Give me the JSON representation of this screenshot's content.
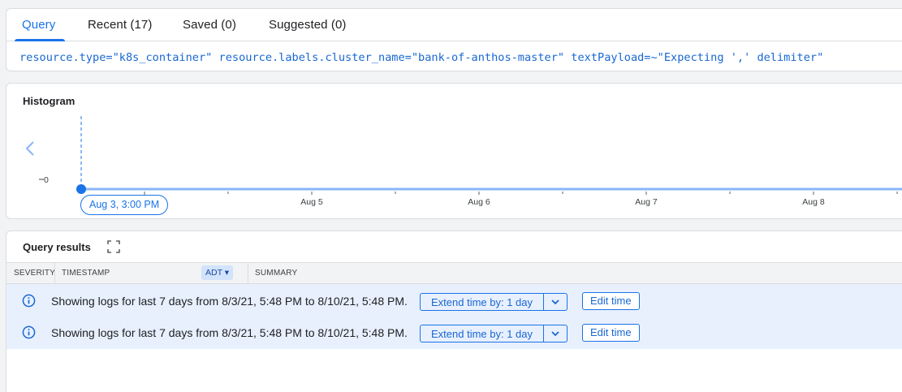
{
  "tabs": [
    {
      "label": "Query",
      "active": true
    },
    {
      "label": "Recent (17)",
      "active": false
    },
    {
      "label": "Saved (0)",
      "active": false
    },
    {
      "label": "Suggested (0)",
      "active": false
    }
  ],
  "query": "resource.type=\"k8s_container\" resource.labels.cluster_name=\"bank-of-anthos-master\" textPayload=~\"Expecting ',' delimiter\"",
  "histogram": {
    "title": "Histogram",
    "y_label": "0",
    "selected_time": "Aug 3, 3:00 PM",
    "tick_labels": [
      "Aug 5",
      "Aug 6",
      "Aug 7",
      "Aug 8"
    ]
  },
  "results": {
    "title": "Query results",
    "columns": {
      "severity": "SEVERITY",
      "timestamp": "TIMESTAMP",
      "timezone": "ADT",
      "summary": "SUMMARY"
    },
    "rows": [
      {
        "message": "Showing logs for last 7 days from 8/3/21, 5:48 PM to 8/10/21, 5:48 PM.",
        "extend_label": "Extend time by: 1 day",
        "edit_label": "Edit time"
      },
      {
        "message": "Showing logs for last 7 days from 8/3/21, 5:48 PM to 8/10/21, 5:48 PM.",
        "extend_label": "Extend time by: 1 day",
        "edit_label": "Edit time"
      }
    ]
  },
  "colors": {
    "accent": "#1a73e8",
    "row_highlight": "#e8f0fe"
  }
}
